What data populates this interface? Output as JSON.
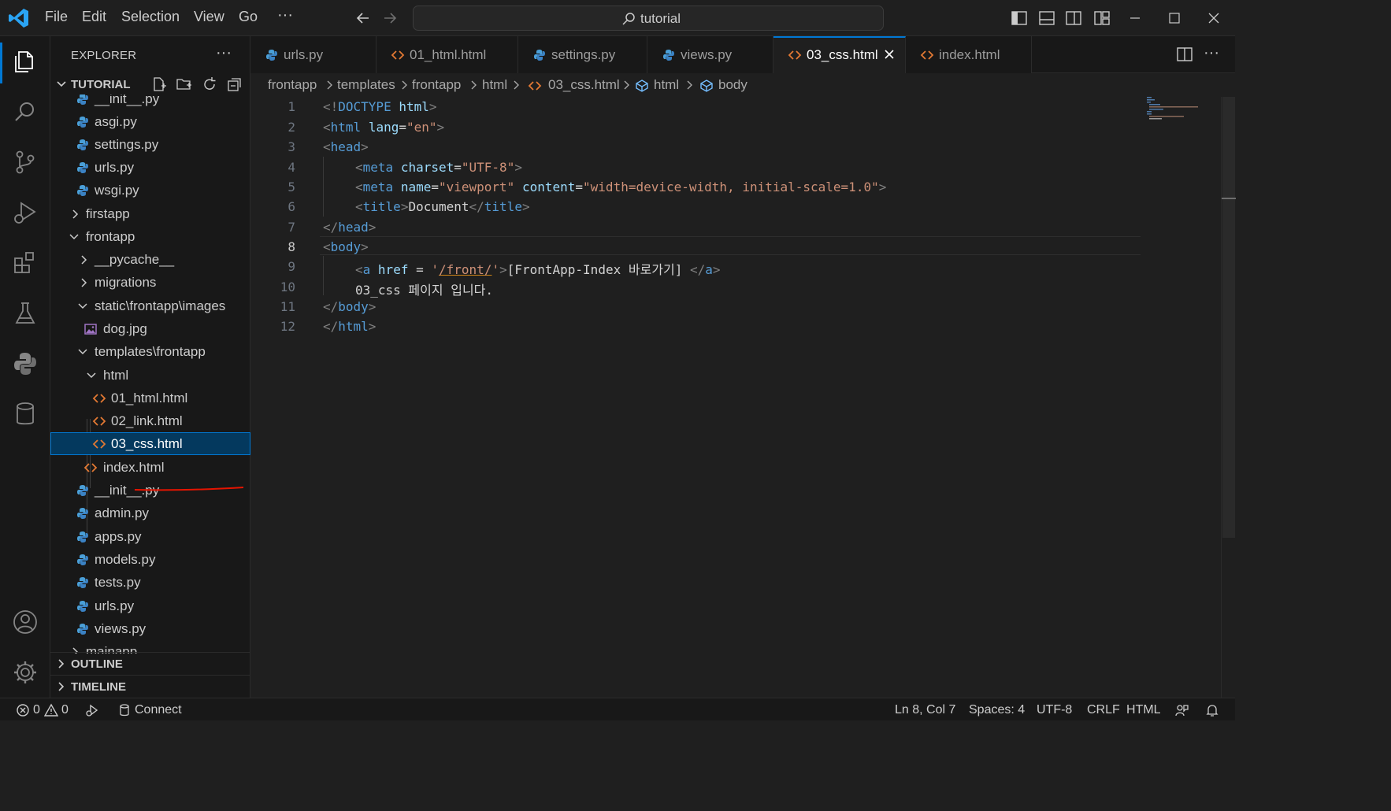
{
  "titlebar": {
    "menu": [
      "File",
      "Edit",
      "Selection",
      "View",
      "Go",
      "···"
    ],
    "command_center": "tutorial"
  },
  "sidebar": {
    "title": "EXPLORER",
    "more": "···",
    "workspace": "TUTORIAL",
    "tree": [
      {
        "label": "__init__.py",
        "type": "py"
      },
      {
        "label": "asgi.py",
        "type": "py"
      },
      {
        "label": "settings.py",
        "type": "py"
      },
      {
        "label": "urls.py",
        "type": "py"
      },
      {
        "label": "wsgi.py",
        "type": "py"
      },
      {
        "label": "firstapp",
        "type": "folder",
        "expanded": false
      },
      {
        "label": "frontapp",
        "type": "folder",
        "expanded": true
      },
      {
        "label": "__pycache__",
        "type": "folder",
        "expanded": false
      },
      {
        "label": "migrations",
        "type": "folder",
        "expanded": false
      },
      {
        "label": "static\\frontapp\\images",
        "type": "folder",
        "expanded": true
      },
      {
        "label": "dog.jpg",
        "type": "image"
      },
      {
        "label": "templates\\frontapp",
        "type": "folder",
        "expanded": true
      },
      {
        "label": "html",
        "type": "folder",
        "expanded": true
      },
      {
        "label": "01_html.html",
        "type": "html"
      },
      {
        "label": "02_link.html",
        "type": "html"
      },
      {
        "label": "03_css.html",
        "type": "html",
        "selected": true
      },
      {
        "label": "index.html",
        "type": "html"
      },
      {
        "label": "__init__.py",
        "type": "py"
      },
      {
        "label": "admin.py",
        "type": "py"
      },
      {
        "label": "apps.py",
        "type": "py"
      },
      {
        "label": "models.py",
        "type": "py"
      },
      {
        "label": "tests.py",
        "type": "py"
      },
      {
        "label": "urls.py",
        "type": "py"
      },
      {
        "label": "views.py",
        "type": "py"
      },
      {
        "label": "mainapp",
        "type": "folder",
        "expanded": false
      }
    ],
    "outline": "OUTLINE",
    "timeline": "TIMELINE"
  },
  "tabs": [
    {
      "label": "urls.py",
      "type": "py"
    },
    {
      "label": "01_html.html",
      "type": "html"
    },
    {
      "label": "settings.py",
      "type": "py"
    },
    {
      "label": "views.py",
      "type": "py"
    },
    {
      "label": "03_css.html",
      "type": "html",
      "active": true
    },
    {
      "label": "index.html",
      "type": "html"
    }
  ],
  "breadcrumb": [
    "frontapp",
    "templates",
    "frontapp",
    "html",
    "03_css.html",
    "html",
    "body"
  ],
  "editor": {
    "current_line": 8,
    "line_numbers": [
      "1",
      "2",
      "3",
      "4",
      "5",
      "6",
      "7",
      "8",
      "9",
      "10",
      "11",
      "12"
    ],
    "code": {
      "l1_open": "<!",
      "l1_doctype": "DOCTYPE",
      "l1_name": " html",
      "l1_close": ">",
      "l2_tag": "html",
      "l2_attr": "lang",
      "l2_eq": "=",
      "l2_val": "\"en\"",
      "l3_tag": "head",
      "l4_tag": "meta",
      "l4_attr": "charset",
      "l4_val": "\"UTF-8\"",
      "l5_tag": "meta",
      "l5_attr1": "name",
      "l5_val1": "\"viewport\"",
      "l5_attr2": "content",
      "l5_val2": "\"width=device-width, initial-scale=1.0\"",
      "l6_tag": "title",
      "l6_text": "Document",
      "l7_tag": "head",
      "l8_tag": "body",
      "l9_tag": "a",
      "l9_attr": "href",
      "l9_eq": " = ",
      "l9_val_q1": "'",
      "l9_val": "/front/",
      "l9_val_q2": "'",
      "l9_text": "[FrontApp-Index 바로가기] ",
      "l10_text": "03_css 페이지 입니다.",
      "l11_tag": "body",
      "l12_tag": "html"
    }
  },
  "statusbar": {
    "errors": "0",
    "warnings": "0",
    "connect": "Connect",
    "position": "Ln 8, Col 7",
    "spaces": "Spaces: 4",
    "encoding": "UTF-8",
    "eol": "CRLF",
    "language": "HTML"
  },
  "colors": {
    "accent": "#0078d4",
    "python_icon": "#4a9fd8",
    "html_icon": "#e37933",
    "image_icon": "#a074c4",
    "annotation_underline": "#e51400"
  }
}
